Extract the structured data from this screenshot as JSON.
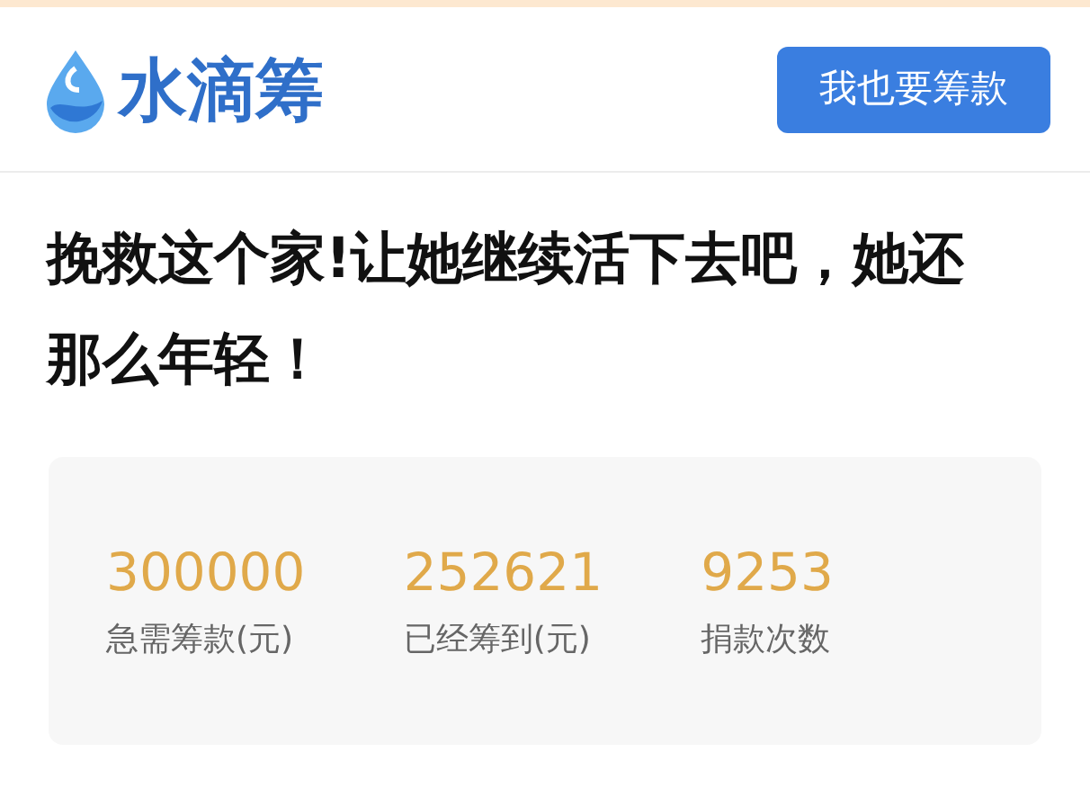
{
  "header": {
    "logo_text": "水滴筹",
    "button": "我也要筹款"
  },
  "title": "挽救这个家!让她继续活下去吧，她还那么年轻！",
  "stats": [
    {
      "value": "300000",
      "label": "急需筹款(元)"
    },
    {
      "value": "252621",
      "label": "已经筹到(元)"
    },
    {
      "value": "9253",
      "label": "捐款次数"
    }
  ]
}
